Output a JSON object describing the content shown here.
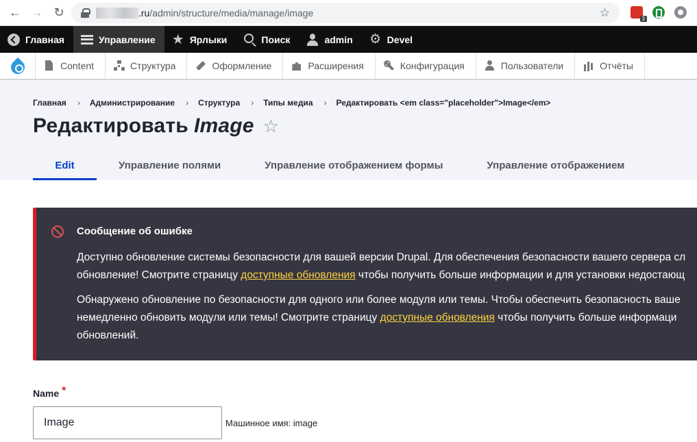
{
  "browser": {
    "url_domain_suffix": ".ru",
    "url_path": "/admin/structure/media/manage/image",
    "extension_badge": "3"
  },
  "toolbar": {
    "items": [
      {
        "label": "Главная"
      },
      {
        "label": "Управление"
      },
      {
        "label": "Ярлыки"
      },
      {
        "label": "Поиск"
      },
      {
        "label": "admin"
      },
      {
        "label": "Devel"
      }
    ]
  },
  "tray": {
    "items": [
      {
        "label": "Content"
      },
      {
        "label": "Структура"
      },
      {
        "label": "Оформление"
      },
      {
        "label": "Расширения"
      },
      {
        "label": "Конфигурация"
      },
      {
        "label": "Пользователи"
      },
      {
        "label": "Отчёты"
      }
    ]
  },
  "breadcrumb": {
    "items": [
      {
        "label": "Главная"
      },
      {
        "label": "Администрирование"
      },
      {
        "label": "Структура"
      },
      {
        "label": "Типы медиа"
      },
      {
        "label": "Редактировать <em class=\"placeholder\">Image</em>"
      }
    ],
    "separator": "›"
  },
  "page": {
    "title_prefix": "Редактировать",
    "title_em": "Image",
    "star": "☆"
  },
  "tabs": [
    {
      "label": "Edit"
    },
    {
      "label": "Управление полями"
    },
    {
      "label": "Управление отображением формы"
    },
    {
      "label": "Управление отображением"
    }
  ],
  "error_message": {
    "title": "Сообщение об ошибке",
    "p1_line1": "Доступно обновление системы безопасности для вашей версии Drupal. Для обеспечения безопасности вашего сервера сл",
    "p1_line2_a": "обновление! Смотрите страницу ",
    "p1_link": "доступные обновления",
    "p1_line2_b": " чтобы получить больше информации и для установки недостающ",
    "p2_line1": "Обнаружено обновление по безопасности для одного или более модуля или темы. Чтобы обеспечить безопасность ваше",
    "p2_line2_a": "немедленно обновить модули или темы! Смотрите страницу ",
    "p2_link": "доступные обновления",
    "p2_line2_b": " чтобы получить больше информаци",
    "p2_line3": "обновлений."
  },
  "form": {
    "name_label": "Name",
    "required_mark": "*",
    "name_value": "Image",
    "machine_name": "Машинное имя: image"
  },
  "colors": {
    "toolbar_bg": "#0f0f0f",
    "header_bg": "#f3f4f9",
    "tab_active": "#003ecc",
    "error_bg": "#353641",
    "error_border": "#d72222",
    "link": "#ffd23f"
  }
}
